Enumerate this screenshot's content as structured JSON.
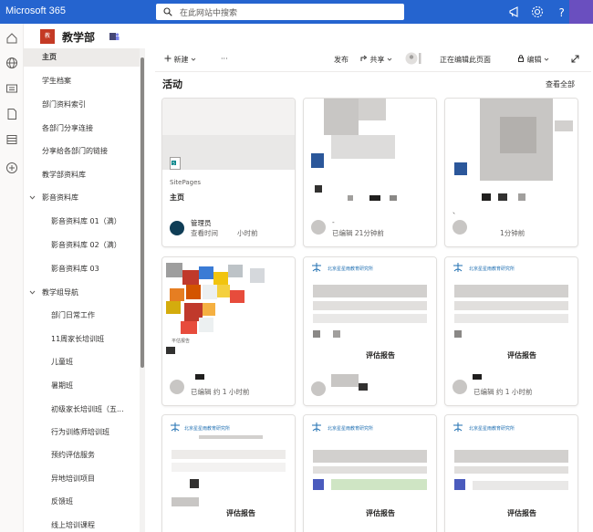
{
  "topbar": {
    "brand": "Microsoft 365",
    "search_placeholder": "在此网站中搜索"
  },
  "site": {
    "logo_text": "教",
    "title": "教学部"
  },
  "nav": {
    "items": [
      {
        "label": "主页",
        "selected": true
      },
      {
        "label": "学生档案"
      },
      {
        "label": "部门资料索引"
      },
      {
        "label": "各部门分享连接"
      },
      {
        "label": "分享给各部门的链接"
      },
      {
        "label": "教学部资料库"
      },
      {
        "label": "影音资料库",
        "group": true
      },
      {
        "label": "影音资料库 01（满）",
        "sub": true
      },
      {
        "label": "影音资料库 02（满）",
        "sub": true
      },
      {
        "label": "影音资料库 03",
        "sub": true
      },
      {
        "label": "教学组导航",
        "group": true
      },
      {
        "label": "部门日常工作",
        "sub": true
      },
      {
        "label": "11周家长培训班",
        "sub": true
      },
      {
        "label": "儿童班",
        "sub": true
      },
      {
        "label": "暑期班",
        "sub": true
      },
      {
        "label": "初级家长培训班（五...",
        "sub": true
      },
      {
        "label": "行为训练师培训班",
        "sub": true
      },
      {
        "label": "预约评估服务",
        "sub": true
      },
      {
        "label": "异地培训项目",
        "sub": true
      },
      {
        "label": "反馈班",
        "sub": true
      },
      {
        "label": "线上培训课程",
        "sub": true
      }
    ]
  },
  "commandbar": {
    "new": "新建",
    "more": "···",
    "publish": "发布",
    "share": "共享",
    "editing_status": "正在编辑此页面",
    "edit": "编辑"
  },
  "activity": {
    "title": "活动",
    "see_all": "查看全部",
    "cards": [
      {
        "category": "SitePages",
        "title": "主页",
        "author": "管理员",
        "meta": "查看时间",
        "time": "小时前"
      },
      {
        "author": "-",
        "meta": "已编辑 21分钟前"
      },
      {
        "author": "、",
        "meta": "1分钟前"
      },
      {
        "title": "评估报告",
        "meta": "已编辑 约 1 小时前"
      },
      {
        "title": "评估报告",
        "meta": ""
      },
      {
        "title": "评估报告",
        "meta": "已编辑 约 1 小时前"
      },
      {
        "title": "评估报告",
        "header": "北京星星雨教育研究所"
      },
      {
        "title": "评估报告",
        "header": "北京星星雨教育研究所"
      },
      {
        "title": "评估报告",
        "header": "北京星星雨教育研究所"
      }
    ],
    "doc_header": "北京星星雨教育研究所"
  },
  "colors": {
    "topbar": "#2564cf",
    "selected_nav": "#edebe9"
  }
}
